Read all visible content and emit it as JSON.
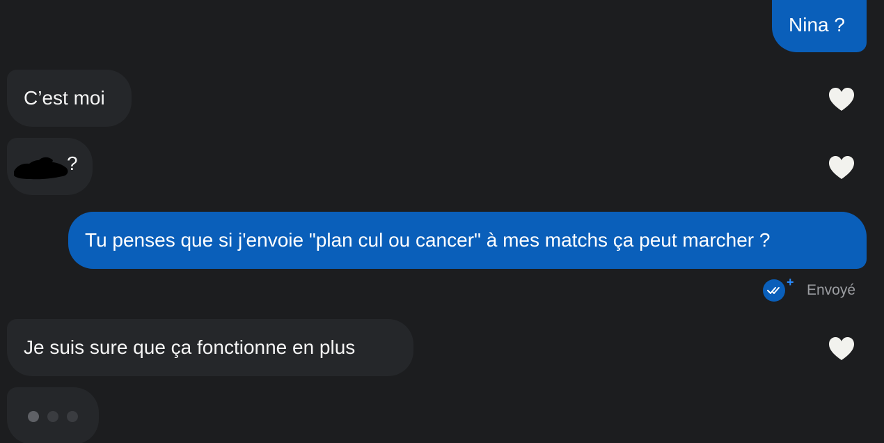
{
  "colors": {
    "background": "#1c1d1f",
    "sent_bubble": "#0a5fba",
    "received_bubble": "#25272a",
    "heart": "#f2f2ee",
    "status_text": "#9b9da1"
  },
  "messages": [
    {
      "direction": "sent",
      "text": "Nina ?"
    },
    {
      "direction": "received",
      "text": "C’est moi",
      "reaction_icon": "heart-icon"
    },
    {
      "direction": "received",
      "text": "?",
      "redacted": true,
      "reaction_icon": "heart-icon"
    },
    {
      "direction": "sent",
      "text": "Tu penses que si j'envoie \"plan cul ou cancer\" à mes matchs ça peut marcher ?"
    },
    {
      "direction": "received",
      "text": "Je suis sure que ça fonctionne en plus",
      "reaction_icon": "heart-icon"
    }
  ],
  "status": {
    "label": "Envoyé",
    "icon": "double-check-icon",
    "badge": "+"
  },
  "typing_indicator": {
    "icon": "typing-dots-icon",
    "dot_count": 3
  }
}
